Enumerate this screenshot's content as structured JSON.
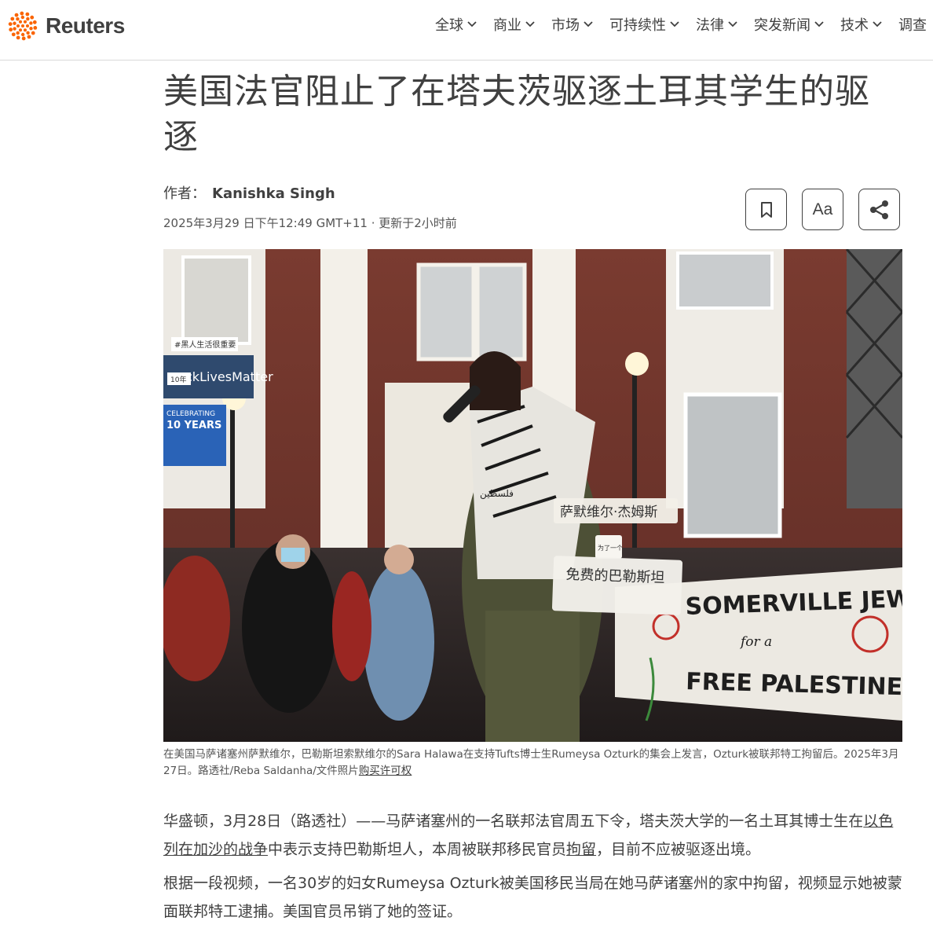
{
  "brand": {
    "name": "Reuters",
    "accent": "#fa6400"
  },
  "nav": {
    "items": [
      {
        "label": "全球",
        "dropdown": true
      },
      {
        "label": "商业",
        "dropdown": true
      },
      {
        "label": "市场",
        "dropdown": true
      },
      {
        "label": "可持续性",
        "dropdown": true
      },
      {
        "label": "法律",
        "dropdown": true
      },
      {
        "label": "突发新闻",
        "dropdown": true
      },
      {
        "label": "技术",
        "dropdown": true
      },
      {
        "label": "调查",
        "dropdown": false
      }
    ]
  },
  "article": {
    "headline": "美国法官阻止了在塔夫茨驱逐土耳其学生的驱逐",
    "byline_prefix": "作者：",
    "author": "Kanishka Singh",
    "dateline": "2025年3月29 日下午12:49 GMT+11 · 更新于2小时前",
    "tools": {
      "bookmark_icon": "bookmark-icon",
      "font_label": "Aa",
      "share_icon": "share-icon"
    },
    "photo": {
      "labels": {
        "sign_top": "#黑人生活很重要",
        "sign_blm": "ckLivesMatter",
        "sign_10": "10年",
        "banner_celebrating": "CELEBRATING",
        "banner_years": "10 YEARS",
        "banner_word1": "SOMERVILLE JEWS",
        "banner_word2": "for a",
        "banner_word3": "FREE PALESTINE",
        "scarf_text": "فلسطين",
        "overlay_name": "萨默维尔·杰姆斯",
        "overlay_for": "为了一个",
        "overlay_free": "免费的巴勒斯坦"
      }
    },
    "caption": {
      "text": "在美国马萨诸塞州萨默维尔，巴勒斯坦索默维尔的Sara Halawa在支持Tufts博士生Rumeysa Ozturk的集会上发言，Ozturk被联邦特工拘留后。2025年3月27日。路透社/Reba Saldanha/文件照片",
      "link": "购买许可权"
    },
    "paragraphs": [
      {
        "pre": "华盛顿，3月28日（路透社）——马萨诸塞州的一名联邦法官周五下令，塔夫茨大学的一名土耳其博士生在",
        "link1": "以色列在加沙的战争",
        "mid": "中表示支持巴勒斯坦人，本周被联邦移民官员",
        "link2": "拘留",
        "post": "，目前不应被驱逐出境。"
      },
      {
        "text": "根据一段视频，一名30岁的妇女Rumeysa Ozturk被美国移民当局在她马萨诸塞州的家中拘留，视频显示她被蒙面联邦特工逮捕。美国官员吊销了她的签证。"
      }
    ]
  }
}
